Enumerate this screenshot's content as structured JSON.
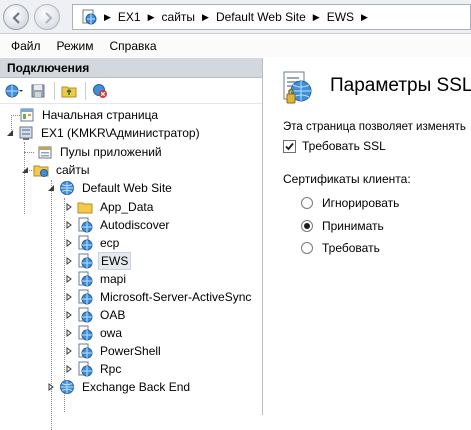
{
  "address": {
    "crumbs": [
      "EX1",
      "сайты",
      "Default Web Site",
      "EWS"
    ]
  },
  "menu": {
    "items": [
      "Файл",
      "Режим",
      "Справка"
    ]
  },
  "connections": {
    "title": "Подключения",
    "tree": {
      "start_page": "Начальная страница",
      "server": "EX1 (KMKR\\Администратор)",
      "app_pools": "Пулы приложений",
      "sites": "сайты",
      "default_site": "Default Web Site",
      "children": [
        "App_Data",
        "Autodiscover",
        "ecp",
        "EWS",
        "mapi",
        "Microsoft-Server-ActiveSync",
        "OAB",
        "owa",
        "PowerShell",
        "Rpc"
      ],
      "backend": "Exchange Back End"
    }
  },
  "ssl": {
    "title": "Параметры SSL",
    "description": "Эта страница позволяет изменять",
    "require_ssl_label": "Требовать SSL",
    "require_ssl_checked": true,
    "client_certs_label": "Сертификаты клиента:",
    "options": [
      "Игнорировать",
      "Принимать",
      "Требовать"
    ],
    "selected_option": "Принимать"
  },
  "colors": {
    "accent": "#2e7bd1",
    "pane_header": "#d3d7de",
    "folder": "#f2c94c"
  }
}
